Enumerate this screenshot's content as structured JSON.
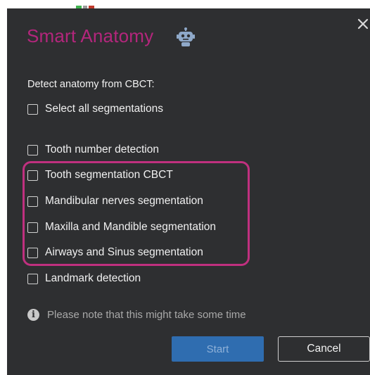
{
  "dialog": {
    "title": "Smart Anatomy",
    "title_icon": "robot-icon",
    "close_icon": "close-icon",
    "subtitle": "Detect anatomy from CBCT:"
  },
  "options": {
    "select_all": "Select all segmentations",
    "tooth_number": "Tooth number detection",
    "tooth_segmentation": "Tooth segmentation CBCT",
    "mandibular_nerves": "Mandibular nerves segmentation",
    "maxilla_mandible": "Maxilla and Mandible segmentation",
    "airways_sinus": "Airways and Sinus segmentation",
    "landmark": "Landmark detection"
  },
  "checked": {
    "select_all": false,
    "tooth_number": false,
    "tooth_segmentation": false,
    "mandibular_nerves": false,
    "maxilla_mandible": false,
    "airways_sinus": false,
    "landmark": false
  },
  "note": {
    "icon": "info-icon",
    "text": "Please note that this might take some time"
  },
  "buttons": {
    "start": "Start",
    "cancel": "Cancel"
  },
  "colors": {
    "dialog_bg": "#2e2f31",
    "title": "#b3267c",
    "highlight": "#c0307f",
    "start_button": "#2f6db0"
  }
}
